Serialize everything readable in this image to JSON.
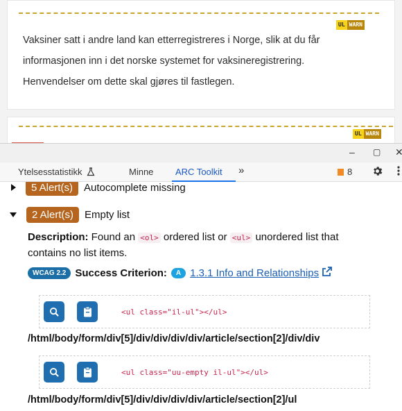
{
  "web": {
    "badge_ul": "UL",
    "badge_warn": "WARN",
    "paragraph_lines": [
      "Vaksiner satt i andre land kan etterregistreres i Norge, slik at du får",
      "informasjonen inn i det norske systemet for vaksineregistrering.",
      "Henvendelser om dette skal gjøres til fastlegen."
    ]
  },
  "window": {
    "minimize": "–",
    "maximize": "▢",
    "close": "✕"
  },
  "devtools": {
    "tabs": [
      "Ytelsesstatistikk",
      "Minne",
      "ARC Toolkit"
    ],
    "more": "»",
    "issues_count": "8",
    "settings_icon": "gear-icon",
    "menu_icon": "kebab-icon"
  },
  "arc": {
    "alert1": {
      "count_label": "5 Alert(s)",
      "title": "Autocomplete missing"
    },
    "alert2": {
      "count_label": "2 Alert(s)",
      "title": "Empty list"
    },
    "description": {
      "label": "Description:",
      "text_a": " Found an ",
      "code_a": "<ol>",
      "text_b": " ordered list or ",
      "code_b": "<ul>",
      "text_c": " unordered list that contains no list items."
    },
    "criterion": {
      "wcag_badge": "WCAG 2.2",
      "label": "Success Criterion:",
      "level": "A",
      "link": "1.3.1 Info and Relationships"
    },
    "snippets": [
      {
        "code": "<ul class=\"il-ul\"></ul>",
        "xpath": "/html/body/form/div[5]/div/div/div/div/article/section[2]/div/div"
      },
      {
        "code": "<ul class=\"uu-empty il-ul\"></ul>",
        "xpath": "/html/body/form/div[5]/div/div/div/div/article/section[2]/ul"
      }
    ]
  }
}
